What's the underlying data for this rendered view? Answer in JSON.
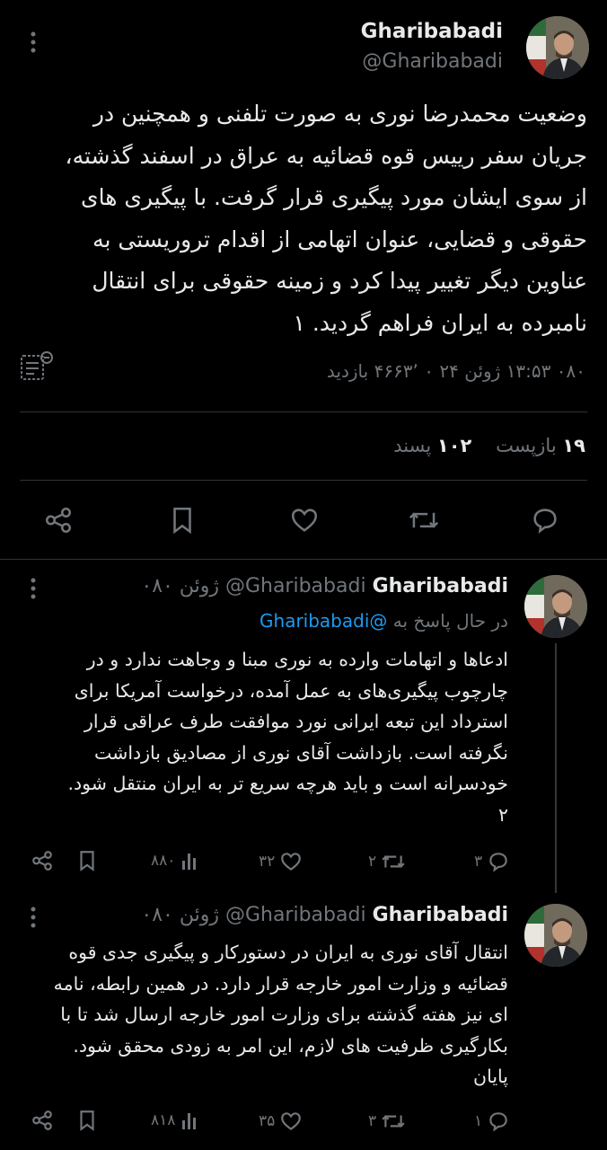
{
  "main_tweet": {
    "display_name": "Gharibabadi",
    "handle": "@Gharibabadi",
    "lines": [
      "وضعیت محمدرضا نوری به صورت تلفنی و همچنین در",
      "جریان سفر رییس قوه قضائیه به عراق در اسفند گذشته،",
      "از سوی ایشان مورد پیگیری قرار گرفت. با پیگیری های",
      "حقوقی و قضایی، عنوان اتهامی از اقدام تروریستی به",
      "عناوین دیگر تغییر پیدا کرد و زمینه حقوقی برای انتقال",
      "نامبرده به ایران فراهم گردید. ۱"
    ],
    "meta": "۰۸۰ ۱۳:۵۳ ژوئن ۲۴ ۰ ۴۶۶۳٬ بازدید",
    "retweets_count": "۱۹",
    "retweets_label": "بازپست",
    "likes_count": "۱۰۲",
    "likes_label": "پسند",
    "icons": [
      "share-icon",
      "bookmark-icon",
      "like-icon",
      "retweet-icon",
      "reply-icon"
    ]
  },
  "reply1": {
    "display_name": "Gharibabadi",
    "handle": "@Gharibabadi",
    "date": "۰۸۰ ژوئن",
    "replying_prefix": "در حال پاسخ به",
    "replying_handle": "@Gharibabadi",
    "lines": [
      "ادعاها و اتهامات وارده به نوری مبنا و وجاهت ندارد و در",
      "چارچوب پیگیری‌های به عمل آمده، درخواست آمریکا برای",
      "استرداد این تبعه ایرانی نورد موافقت طرف عراقی قرار",
      "نگرفته است. بازداشت آقای نوری از مصادیق بازداشت",
      "خودسرانه است و باید هرچه سریع تر به ایران منتقل شود.",
      "۲"
    ],
    "views": "۸۸۰",
    "likes": "۳۲",
    "retweets": "۲",
    "replies": "۳"
  },
  "reply2": {
    "display_name": "Gharibabadi",
    "handle": "@Gharibabadi",
    "date": "۰۸۰ ژوئن",
    "lines": [
      "انتقال آقای نوری به ایران در دستورکار و پیگیری  جدی قوه",
      "قضائیه و وزارت امور خارجه قرار دارد. در همین رابطه، نامه",
      "ای نیز هفته گذشته برای وزارت امور خارجه ارسال شد تا با",
      "بکارگیری ظرفیت های لازم، این امر به زودی محقق شود.",
      "پایان"
    ],
    "views": "۸۱۸",
    "likes": "۳۵",
    "retweets": "۳",
    "replies": "۱"
  }
}
